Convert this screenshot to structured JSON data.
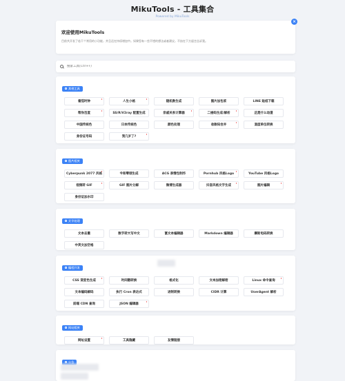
{
  "header": {
    "title": "MikuTools - 工具集合",
    "subtitle": "Powered by MikuTools"
  },
  "welcome": {
    "title": "欢迎使用MikuTools",
    "desc": "目前共开发了若干个常用的小功能，并且还在持续增加中。如果您有一些不错的想法或者建议，不妨在下方留言告诉我。",
    "close_label": "×"
  },
  "search": {
    "placeholder": "搜索工具(Ctrl+F)"
  },
  "sections": [
    {
      "name": "其他工具",
      "tools": [
        {
          "label": "番茄时钟",
          "dot": true
        },
        {
          "label": "人生小格",
          "dot": true
        },
        {
          "label": "随机数生成",
          "dot": false
        },
        {
          "label": "图片加包浆",
          "dot": false
        },
        {
          "label": "LINE 贴纸下载",
          "dot": false
        },
        {
          "label": "帮你百度",
          "dot": true
        },
        {
          "label": "SS/R/V2ray 配置生成",
          "dot": false
        },
        {
          "label": "亲戚关系计算器",
          "dot": true
        },
        {
          "label": "二维码生成/解析",
          "dot": true
        },
        {
          "label": "这是什么动漫",
          "dot": false
        },
        {
          "label": "中国传统色",
          "dot": false
        },
        {
          "label": "日本传统色",
          "dot": false
        },
        {
          "label": "颜色处理",
          "dot": false
        },
        {
          "label": "收款码合并",
          "dot": true
        },
        {
          "label": "温度单位转换",
          "dot": false
        },
        {
          "label": "身份证号码",
          "dot": false
        },
        {
          "label": "我几岁了?",
          "dot": true
        }
      ]
    },
    {
      "name": "图片相关",
      "tools": [
        {
          "label": "Cyberpunk 2077 风格",
          "dot": true
        },
        {
          "label": "今和零颂生成",
          "dot": false
        },
        {
          "label": "ACG 表情包制作",
          "dot": false
        },
        {
          "label": "Pornhub 风格Logo",
          "dot": true
        },
        {
          "label": "YouTube 风格Logo",
          "dot": false
        },
        {
          "label": "视频转 GIF",
          "dot": true
        },
        {
          "label": "GIF 图片分解",
          "dot": false
        },
        {
          "label": "微博生成器",
          "dot": false
        },
        {
          "label": "抖音风格文字生成",
          "dot": true
        },
        {
          "label": "图片编辑",
          "dot": true
        },
        {
          "label": "身份证加水印",
          "dot": false
        }
      ]
    },
    {
      "name": "文字处理",
      "tools": [
        {
          "label": "文本去重",
          "dot": false
        },
        {
          "label": "数字转大写中文",
          "dot": false
        },
        {
          "label": "富文本编辑器",
          "dot": false
        },
        {
          "label": "Markdown 编辑器",
          "dot": false
        },
        {
          "label": "摩斯电码转换",
          "dot": false
        },
        {
          "label": "中英文加空格",
          "dot": false
        }
      ]
    },
    {
      "name": "编程开发",
      "tools": [
        {
          "label": "CSS 渐变色生成",
          "dot": true
        },
        {
          "label": "时间戳转换",
          "dot": false
        },
        {
          "label": "格式化",
          "dot": false
        },
        {
          "label": "文本加密解密",
          "dot": false
        },
        {
          "label": "Linux 命令查询",
          "dot": true
        },
        {
          "label": "文本编码解码",
          "dot": false
        },
        {
          "label": "执行 Cron 表达式",
          "dot": false
        },
        {
          "label": "进制转换",
          "dot": false
        },
        {
          "label": "CIDR 计算",
          "dot": false
        },
        {
          "label": "UserAgent 解析",
          "dot": false
        },
        {
          "label": "前端 CDN 查询",
          "dot": false
        },
        {
          "label": "JSON 编辑器",
          "dot": true
        }
      ]
    },
    {
      "name": "网站相关",
      "tools": [
        {
          "label": "网址设置",
          "dot": true
        },
        {
          "label": "工具隐藏",
          "dot": false
        },
        {
          "label": "友情链接",
          "dot": false
        }
      ]
    },
    {
      "name": "公告",
      "tools": []
    }
  ],
  "colors": {
    "accent": "#3b82f6",
    "dot": "#f06a6a",
    "background": "#f1f3f7"
  }
}
